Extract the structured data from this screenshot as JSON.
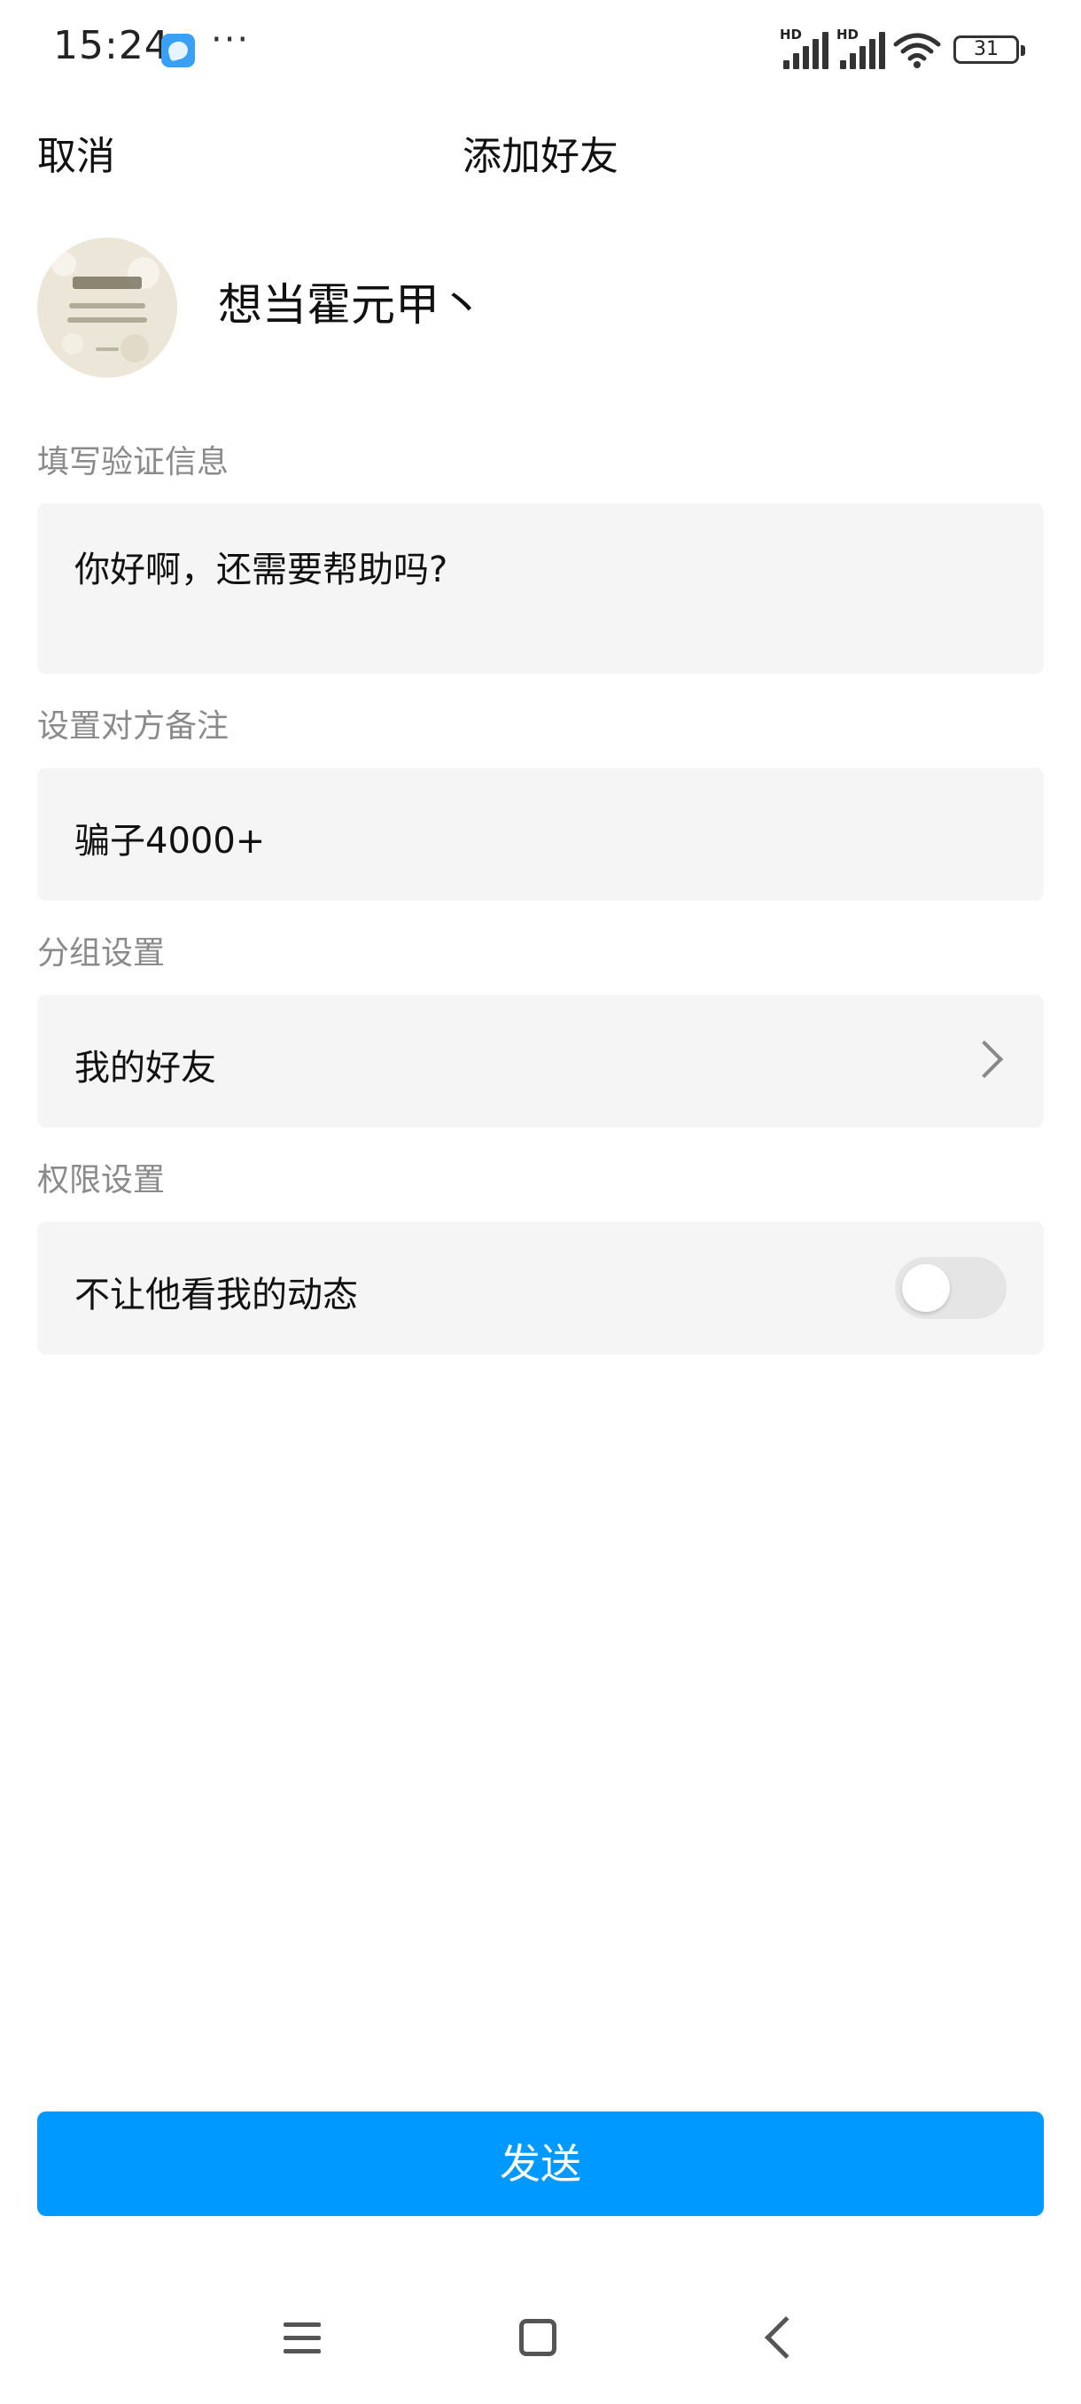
{
  "status_bar": {
    "time": "15:24",
    "more": "···",
    "signal1_label": "HD",
    "signal2_label": "HD",
    "battery": "31",
    "app_icon": "message-app-icon",
    "wifi_icon": "wifi-icon"
  },
  "header": {
    "cancel_label": "取消",
    "title": "添加好友"
  },
  "profile": {
    "name": "想当霍元甲丶",
    "avatar_icon": "avatar-image"
  },
  "verification": {
    "label": "填写验证信息",
    "value": "你好啊，还需要帮助吗?"
  },
  "remark": {
    "label": "设置对方备注",
    "value": "骗子4000+"
  },
  "group": {
    "label": "分组设置",
    "value": "我的好友",
    "chevron_icon": "chevron-right-icon"
  },
  "permission": {
    "label": "权限设置",
    "option_label": "不让他看我的动态",
    "toggle_on": false
  },
  "send_button_label": "发送",
  "system_nav": {
    "menu_icon": "menu-icon",
    "home_icon": "home-icon",
    "back_icon": "back-icon"
  },
  "colors": {
    "accent": "#0099ff",
    "field_bg": "#f5f5f5",
    "label_gray": "#8a8a8a"
  }
}
